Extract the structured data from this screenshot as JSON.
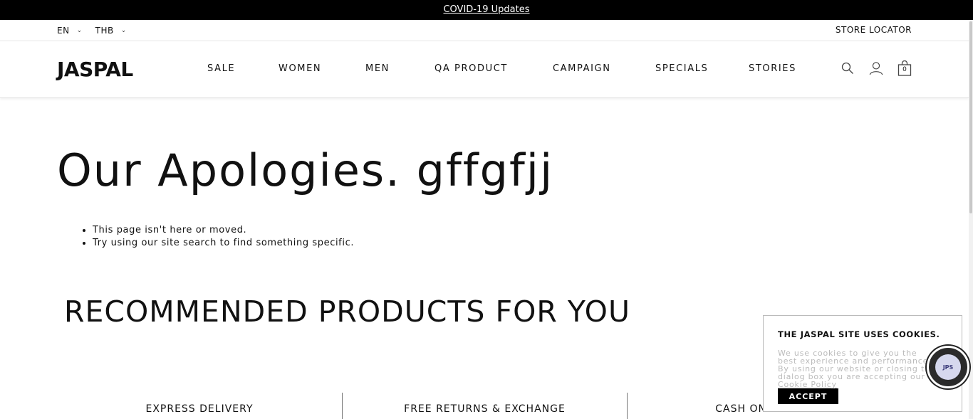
{
  "promo": {
    "link_text": "COVID-19 Updates"
  },
  "utility": {
    "language": "EN",
    "currency": "THB",
    "store_locator": "STORE LOCATOR"
  },
  "header": {
    "logo": "JASPAL",
    "nav": [
      "SALE",
      "WOMEN",
      "MEN",
      "QA PRODUCT",
      "CAMPAIGN",
      "SPECIALS",
      "STORIES"
    ],
    "cart_count": "0",
    "icons": [
      "search-icon",
      "account-icon",
      "shopping-bag-icon"
    ]
  },
  "main": {
    "title": "Our Apologies. gffgfjj",
    "tips": [
      "This page isn't here or moved.",
      "Try using our site search to find something specific."
    ],
    "recommended_title": "RECOMMENDED PRODUCTS FOR YOU"
  },
  "features": [
    "EXPRESS DELIVERY",
    "FREE RETURNS & EXCHANGE",
    "CASH ON DELIVERY"
  ],
  "cookie": {
    "title": "THE JASPAL SITE USES COOKIES.",
    "text": "We use cookies to give you the best experience and performance. By using our website or closing this dialog box you are accepting our",
    "link": "Cookie Policy",
    "accept": "ACCEPT"
  },
  "chat": {
    "badge": "JPS"
  },
  "colors": {
    "topbar": "#000000",
    "text": "#111111",
    "muted": "#bbbbbb"
  }
}
